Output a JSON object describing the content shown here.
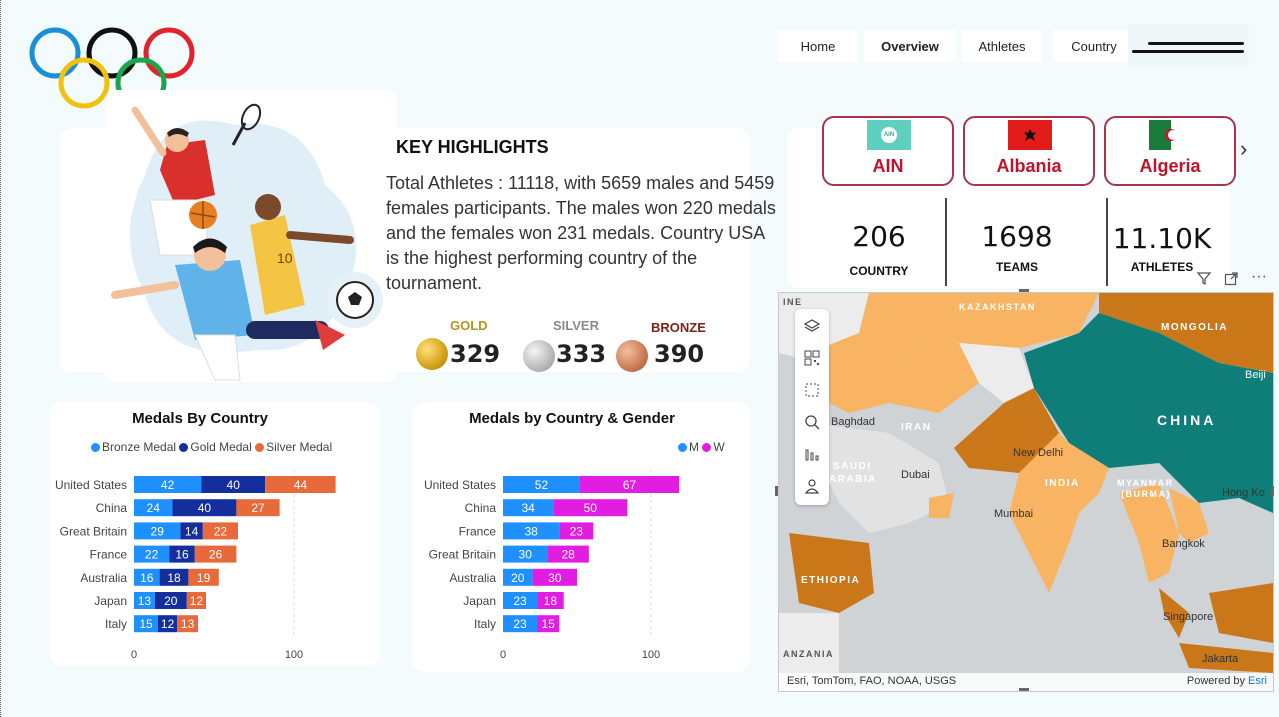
{
  "nav": {
    "tabs": [
      "Home",
      "Overview",
      "Athletes",
      "Country"
    ],
    "active": "Overview"
  },
  "highlights": {
    "title": "KEY HIGHLIGHTS",
    "text": "Total Athletes : 11118, with 5659 males and 5459 females participants. The males won 220 medals and the females won 231 medals. Country USA is the highest performing country of the tournament."
  },
  "medals": {
    "gold": {
      "label": "GOLD",
      "value": "329",
      "color": "#b8941f"
    },
    "silver": {
      "label": "SILVER",
      "value": "333",
      "color": "#8a8a8a"
    },
    "bronze": {
      "label": "BRONZE",
      "value": "390",
      "color": "#7a2416"
    }
  },
  "countries": [
    {
      "name": "AIN",
      "flag_badge": "AIN"
    },
    {
      "name": "Albania"
    },
    {
      "name": "Algeria"
    }
  ],
  "kpis": [
    {
      "value": "206",
      "label": "COUNTRY"
    },
    {
      "value": "1698",
      "label": "TEAMS"
    },
    {
      "value": "11.10K",
      "label": "ATHLETES"
    }
  ],
  "chart_data": [
    {
      "type": "bar",
      "orientation": "horizontal-stacked",
      "title": "Medals By Country",
      "categories": [
        "United States",
        "China",
        "Great Britain",
        "France",
        "Australia",
        "Japan",
        "Italy"
      ],
      "series": [
        {
          "name": "Bronze Medal",
          "color": "#1e90ff",
          "values": [
            42,
            24,
            29,
            22,
            16,
            13,
            15
          ]
        },
        {
          "name": "Gold Medal",
          "color": "#142e9e",
          "values": [
            40,
            40,
            14,
            16,
            18,
            20,
            12
          ]
        },
        {
          "name": "Silver Medal",
          "color": "#e8693a",
          "values": [
            44,
            27,
            22,
            26,
            19,
            12,
            13
          ]
        }
      ],
      "x_ticks": [
        "0",
        "100"
      ],
      "xlim": [
        0,
        126
      ],
      "legend": "top"
    },
    {
      "type": "bar",
      "orientation": "horizontal-stacked",
      "title": "Medals by Country & Gender",
      "categories": [
        "United States",
        "China",
        "France",
        "Great Britain",
        "Australia",
        "Japan",
        "Italy"
      ],
      "series": [
        {
          "name": "M",
          "color": "#1e90ff",
          "values": [
            52,
            34,
            38,
            30,
            20,
            23,
            23
          ]
        },
        {
          "name": "W",
          "color": "#e21de2",
          "values": [
            67,
            50,
            23,
            28,
            30,
            18,
            15
          ]
        }
      ],
      "x_ticks": [
        "0",
        "100"
      ],
      "xlim": [
        0,
        126
      ],
      "legend": "top-right"
    }
  ],
  "map": {
    "labels": {
      "kazakhstan": "KAZAKHSTAN",
      "mongolia": "MONGOLIA",
      "china": "CHINA",
      "iran": "IRAN",
      "india": "INDIA",
      "saudi": "SAUDI",
      "arabia": "ARABIA",
      "ethiopia": "ETHIOPIA",
      "myanmar": "MYANMAR",
      "burma": "(BURMA)",
      "baghdad": "Baghdad",
      "dubai": "Dubai",
      "new_delhi": "New Delhi",
      "mumbai": "Mumbai",
      "bangkok": "Bangkok",
      "singapore": "Singapore",
      "jakarta": "Jakarta",
      "hong_kong": "Hong Ko",
      "beijing": "Beiji",
      "tanzania": "ANZANIA",
      "edge_ine": "INE"
    },
    "attribution": "Esri, TomTom, FAO, NOAA, USGS",
    "powered_by": "Powered by",
    "esri": "Esri",
    "tools": [
      "layers-icon",
      "qr-icon",
      "select-icon",
      "search-icon",
      "chart-icon",
      "person-icon"
    ]
  }
}
